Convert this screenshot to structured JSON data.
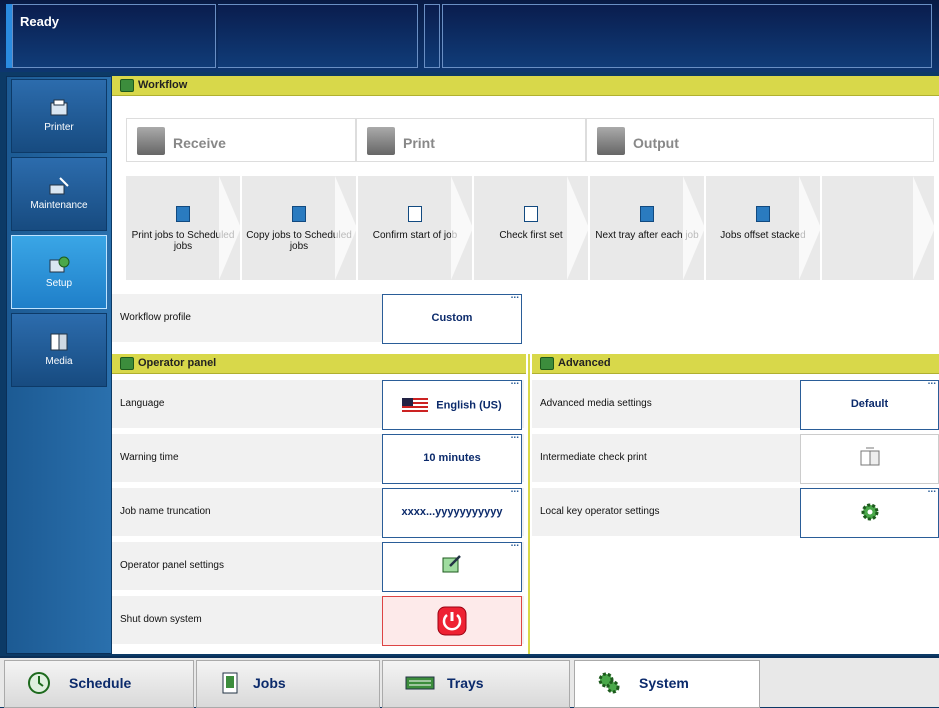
{
  "status": {
    "text": "Ready"
  },
  "sidebar": {
    "items": [
      {
        "label": "Printer",
        "icon": "printer-icon",
        "active": false
      },
      {
        "label": "Maintenance",
        "icon": "maintenance-icon",
        "active": false
      },
      {
        "label": "Setup",
        "icon": "setup-icon",
        "active": true
      },
      {
        "label": "Media",
        "icon": "media-icon",
        "active": false
      }
    ]
  },
  "workflow": {
    "title": "Workflow",
    "stages": [
      {
        "label": "Receive",
        "icon": "receive-icon"
      },
      {
        "label": "Print",
        "icon": "print-icon"
      },
      {
        "label": "Output",
        "icon": "output-icon"
      }
    ],
    "tiles": [
      {
        "label": "Print jobs to Scheduled jobs",
        "icon": "scheduled-jobs-icon"
      },
      {
        "label": "Copy jobs to Scheduled jobs",
        "icon": "copy-scheduled-icon"
      },
      {
        "label": "Confirm start of job",
        "icon": "confirm-job-icon"
      },
      {
        "label": "Check first set",
        "icon": "check-set-icon"
      },
      {
        "label": "Next tray after each job",
        "icon": "tray-icon"
      },
      {
        "label": "Jobs offset stacked",
        "icon": "offset-stack-icon"
      }
    ],
    "profile": {
      "label": "Workflow profile",
      "value": "Custom"
    }
  },
  "operator_panel": {
    "title": "Operator panel",
    "rows": [
      {
        "label": "Language",
        "value": "English (US)",
        "icon": "us-flag-icon"
      },
      {
        "label": "Warning time",
        "value": "10 minutes"
      },
      {
        "label": "Job name truncation",
        "value": "xxxx...yyyyyyyyyyy"
      },
      {
        "label": "Operator panel settings",
        "icon": "edit-icon"
      },
      {
        "label": "Shut down system",
        "icon": "power-icon"
      }
    ]
  },
  "advanced": {
    "title": "Advanced",
    "rows": [
      {
        "label": "Advanced media settings",
        "value": "Default"
      },
      {
        "label": "Intermediate check print",
        "icon": "check-print-icon"
      },
      {
        "label": "Local key operator settings",
        "icon": "gear-icon"
      }
    ]
  },
  "tabs": [
    {
      "label": "Schedule",
      "icon": "clock-icon"
    },
    {
      "label": "Jobs",
      "icon": "jobs-icon"
    },
    {
      "label": "Trays",
      "icon": "trays-icon"
    },
    {
      "label": "System",
      "icon": "system-icon",
      "active": true
    }
  ],
  "colors": {
    "accent": "#1f7fc9",
    "header": "#d8d84a",
    "dark": "#0d3670"
  }
}
